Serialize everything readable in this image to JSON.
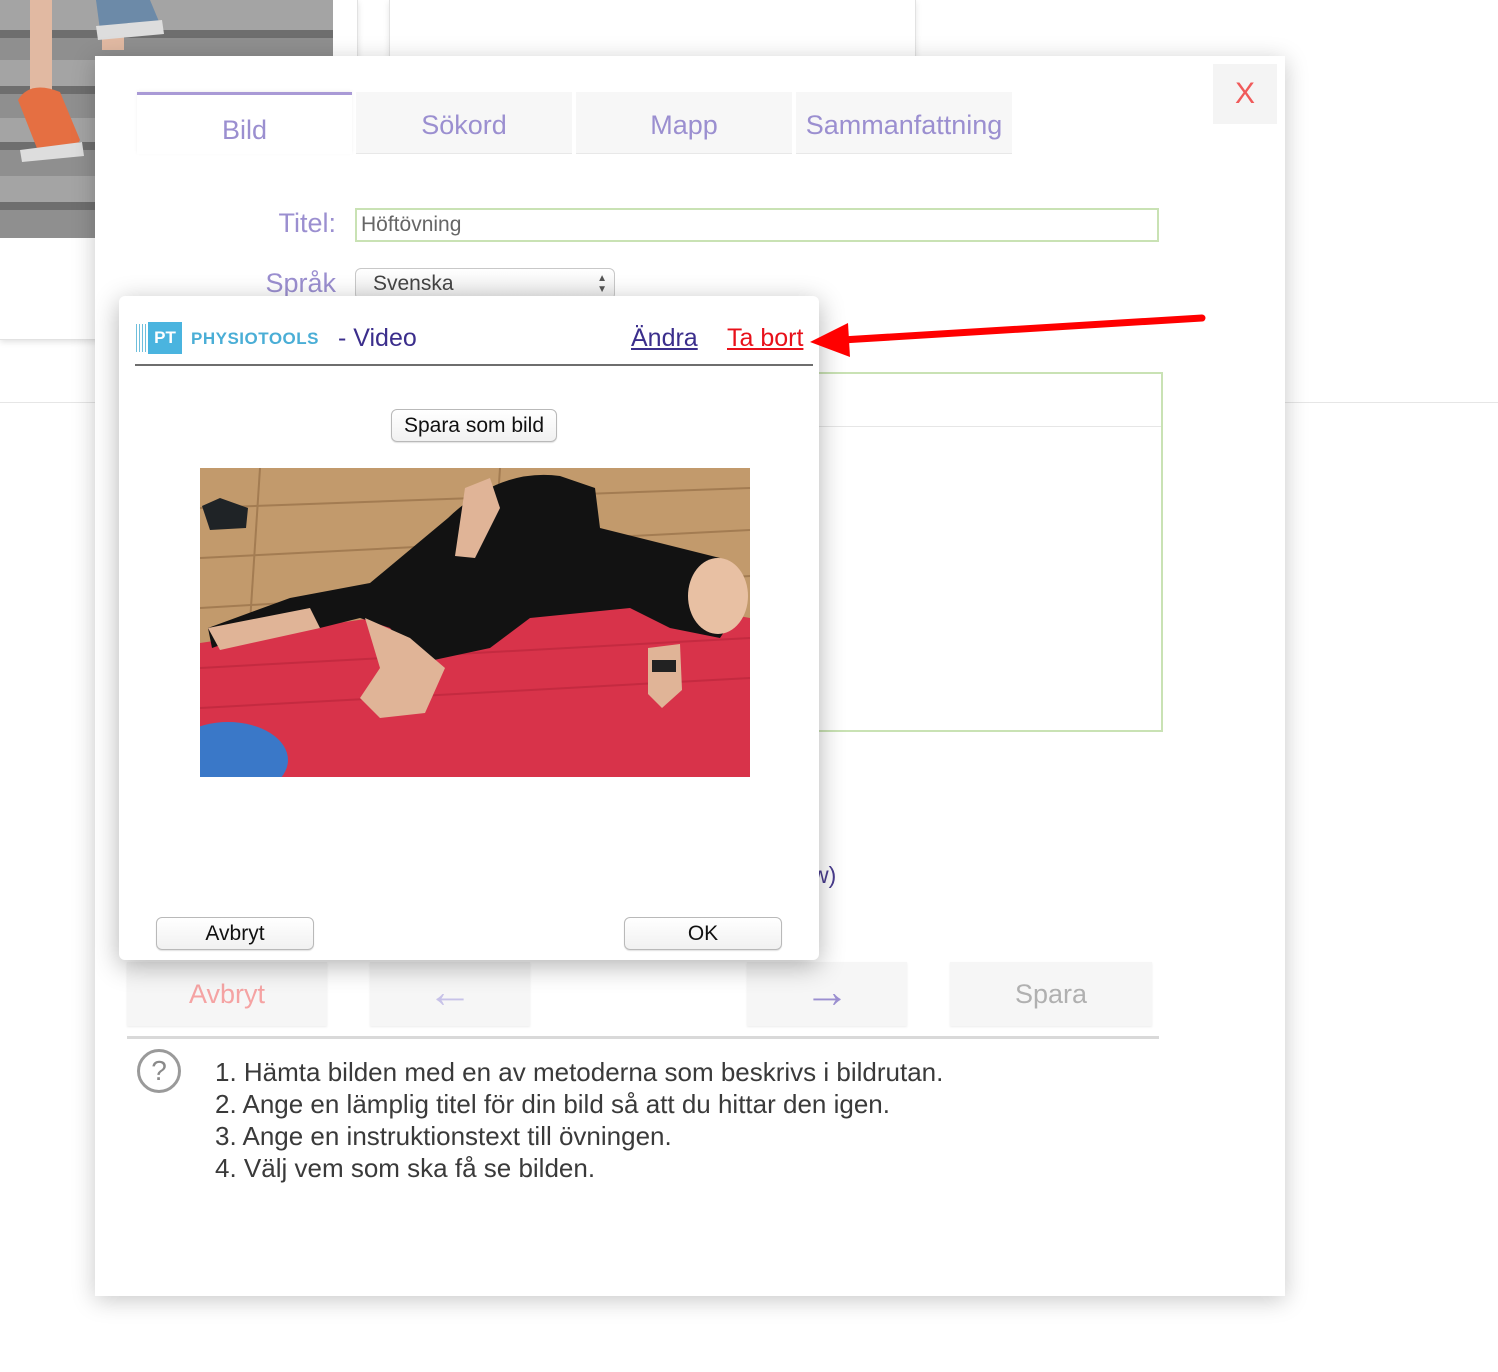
{
  "dialog": {
    "close_label": "X",
    "tabs": [
      {
        "label": "Bild",
        "active": true
      },
      {
        "label": "Sökord",
        "active": false
      },
      {
        "label": "Mapp",
        "active": false
      },
      {
        "label": "Sammanfattning",
        "active": false
      }
    ],
    "title_label": "Titel:",
    "title_value": "Höftövning",
    "language_label": "Språk",
    "language_value": "Svenska",
    "partial_text": "w)",
    "buttons": {
      "cancel": "Avbryt",
      "prev": "←",
      "next": "→",
      "save": "Spara"
    },
    "help_icon_label": "?",
    "help_steps": [
      "1. Hämta bilden med en av metoderna som beskrivs i bildrutan.",
      "2. Ange en lämplig titel för din bild så att du hittar den igen.",
      "3. Ange en instruktionstext till övningen.",
      "4. Välj vem som ska få se bilden."
    ]
  },
  "video_modal": {
    "logo_text": "PT",
    "brand": "PHYSIOTOOLS",
    "title": "- Video",
    "edit_link": "Ändra",
    "delete_link": "Ta bort",
    "save_as_image": "Spara som bild",
    "cancel": "Avbryt",
    "ok": "OK"
  },
  "icons": {
    "close": "close-icon",
    "help": "question-circle-icon",
    "prev": "arrow-left-icon",
    "next": "arrow-right-icon",
    "select": "updown-chevron-icon"
  },
  "colors": {
    "accent": "#9b8fd0",
    "link": "#3b2e8c",
    "danger": "#e8101a",
    "brand": "#4ab4df",
    "annotation": "#ff0000"
  }
}
